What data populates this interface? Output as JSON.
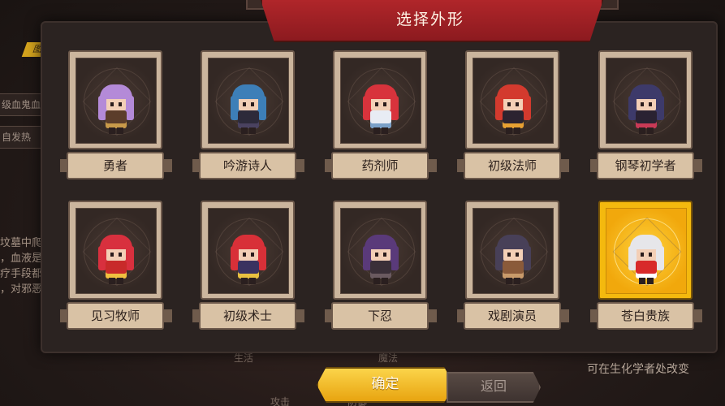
{
  "dialog": {
    "title": "选择外形"
  },
  "characters": [
    {
      "label": "勇者",
      "hair": "#b48ad8",
      "body": "#5b3d2a",
      "accent": "#c89a4a",
      "selected": false
    },
    {
      "label": "吟游诗人",
      "hair": "#3d7fb8",
      "body": "#2d2a3a",
      "accent": "#4a4260",
      "selected": false
    },
    {
      "label": "药剂师",
      "hair": "#d8333c",
      "body": "#e8ecf4",
      "accent": "#7aa0c8",
      "selected": false
    },
    {
      "label": "初级法师",
      "hair": "#d33a2e",
      "body": "#2c2330",
      "accent": "#e6a032",
      "selected": false
    },
    {
      "label": "钢琴初学者",
      "hair": "#3d3a6a",
      "body": "#2a2232",
      "accent": "#c83a56",
      "selected": false
    },
    {
      "label": "见习牧师",
      "hair": "#d8303e",
      "body": "#c82a2a",
      "accent": "#f0c040",
      "selected": false
    },
    {
      "label": "初级术士",
      "hair": "#d83038",
      "body": "#3a3260",
      "accent": "#e8c040",
      "selected": false
    },
    {
      "label": "下忍",
      "hair": "#5a3a7a",
      "body": "#3a2f38",
      "accent": "#6a5a60",
      "selected": false
    },
    {
      "label": "戏剧演员",
      "hair": "#484058",
      "body": "#8a5a3a",
      "accent": "#c89a6a",
      "selected": false
    },
    {
      "label": "苍白贵族",
      "hair": "#e6e6ea",
      "body": "#d82a2a",
      "accent": "#ffffff",
      "selected": true
    }
  ],
  "buttons": {
    "confirm": "确定",
    "back": "返回"
  },
  "background": {
    "badge": "图鉴",
    "tags": [
      "级血鬼血",
      "自发热"
    ],
    "lines": [
      "坟墓中爬",
      "，血液是属",
      "疗手段都对",
      "，对邪恶"
    ],
    "labels": [
      "生活",
      "魔法",
      "攻击",
      "防御"
    ],
    "hint": "可在生化学者处改变"
  },
  "colors": {
    "title_banner": "#a6232a",
    "selected_frame": "#f4b90e",
    "confirm_button": "#f2bc2c"
  }
}
